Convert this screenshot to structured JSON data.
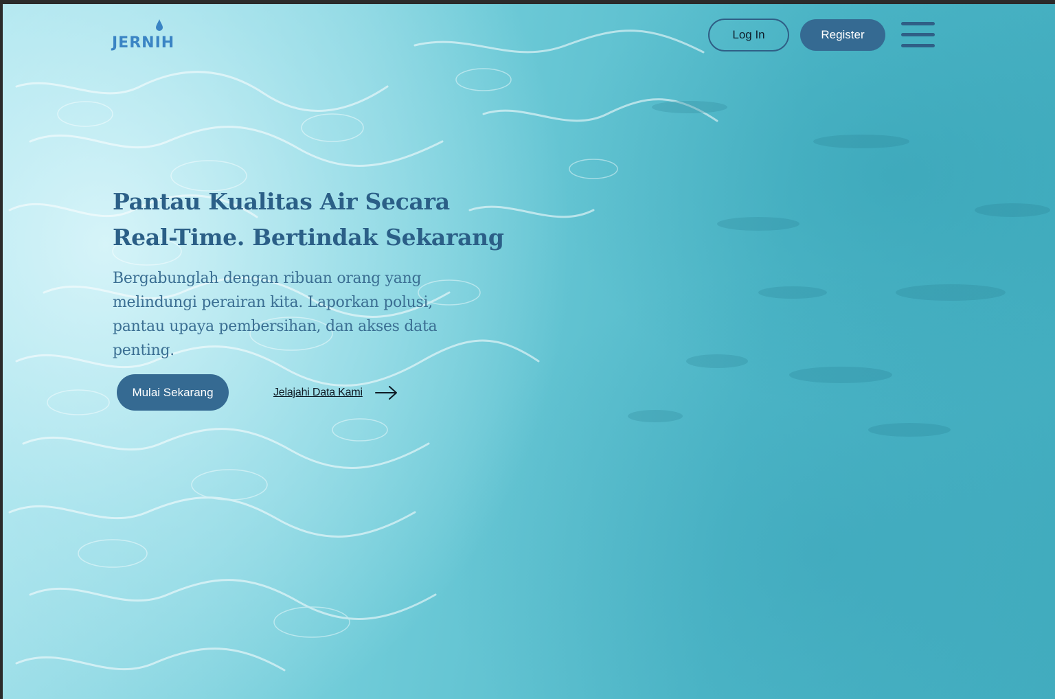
{
  "brand": {
    "logo_text": "JERNIH"
  },
  "nav": {
    "login_label": "Log In",
    "register_label": "Register",
    "menu_icon": "hamburger-menu-icon"
  },
  "hero": {
    "title_line1": "Pantau Kualitas Air Secara",
    "title_line2": "Real-Time. Bertindak Sekarang",
    "subtitle": "Bergabunglah dengan ribuan orang yang melindungi perairan kita. Laporkan polusi, pantau upaya pembersihan, dan akses data penting.",
    "primary_cta": "Mulai Sekarang",
    "secondary_cta": "Jelajahi Data Kami",
    "secondary_icon": "arrow-right-icon"
  },
  "colors": {
    "primary": "#356a92",
    "heading": "#2b5f87",
    "logo": "#3a84c4",
    "background_water": "#4eb7c8"
  }
}
